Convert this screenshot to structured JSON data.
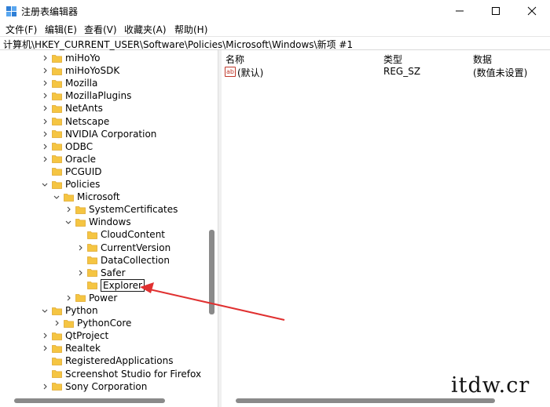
{
  "window": {
    "title": "注册表编辑器",
    "controls": {
      "minimize": "minimize",
      "maximize": "maximize",
      "close": "close"
    }
  },
  "menu": [
    "文件(F)",
    "编辑(E)",
    "查看(V)",
    "收藏夹(A)",
    "帮助(H)"
  ],
  "address": "计算机\\HKEY_CURRENT_USER\\Software\\Policies\\Microsoft\\Windows\\新项 #1",
  "tree": [
    {
      "label": "miHoYo",
      "chevron": "right"
    },
    {
      "label": "miHoYoSDK",
      "chevron": "right"
    },
    {
      "label": "Mozilla",
      "chevron": "right"
    },
    {
      "label": "MozillaPlugins",
      "chevron": "right"
    },
    {
      "label": "NetAnts",
      "chevron": "right"
    },
    {
      "label": "Netscape",
      "chevron": "right"
    },
    {
      "label": "NVIDIA Corporation",
      "chevron": "right"
    },
    {
      "label": "ODBC",
      "chevron": "right"
    },
    {
      "label": "Oracle",
      "chevron": "right"
    },
    {
      "label": "PCGUID",
      "chevron": "none"
    },
    {
      "label": "Policies",
      "chevron": "down"
    },
    {
      "label": "Microsoft",
      "chevron": "down"
    },
    {
      "label": "SystemCertificates",
      "chevron": "right"
    },
    {
      "label": "Windows",
      "chevron": "down"
    },
    {
      "label": "CloudContent",
      "chevron": "none"
    },
    {
      "label": "CurrentVersion",
      "chevron": "right"
    },
    {
      "label": "DataCollection",
      "chevron": "none"
    },
    {
      "label": "Safer",
      "chevron": "right"
    },
    {
      "label": "Explorer",
      "chevron": "none",
      "editing": true
    },
    {
      "label": "Power",
      "chevron": "right"
    },
    {
      "label": "Python",
      "chevron": "down"
    },
    {
      "label": "PythonCore",
      "chevron": "right"
    },
    {
      "label": "QtProject",
      "chevron": "right"
    },
    {
      "label": "Realtek",
      "chevron": "right"
    },
    {
      "label": "RegisteredApplications",
      "chevron": "none"
    },
    {
      "label": "Screenshot Studio for Firefox",
      "chevron": "none"
    },
    {
      "label": "Sony Corporation",
      "chevron": "right"
    }
  ],
  "list": {
    "columns": {
      "name": "名称",
      "type": "类型",
      "data": "数据"
    },
    "rows": [
      {
        "icon": "ab",
        "name": "(默认)",
        "type": "REG_SZ",
        "data": "(数值未设置)"
      }
    ]
  },
  "watermark": "itdw.cr",
  "colors": {
    "folder": "#f5c542",
    "folder_dark": "#e0a82e",
    "arrow": "#e03030"
  }
}
